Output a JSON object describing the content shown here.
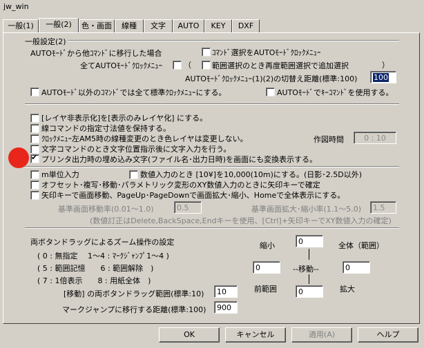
{
  "window": {
    "title": "jw_win"
  },
  "tabs": [
    "一般(1)",
    "一般(2)",
    "色・画面",
    "線種",
    "文字",
    "AUTO",
    "KEY",
    "DXF"
  ],
  "section_title": "一般設定(2)",
  "auto": {
    "heading": "AUTOﾓｰﾄﾞから他ｺﾏﾝﾄﾞに移行した場合",
    "cmd_select_label": "ｺﾏﾝﾄﾞ選択をAUTOﾓｰﾄﾞｸﾛｯｸﾒﾆｭｰ",
    "all_clock_label": "全てAUTOﾓｰﾄﾞｸﾛｯｸﾒﾆｭｰ",
    "range_select_label": "範囲選択のとき再度範囲選択で追加選択",
    "open_paren": "（",
    "close_paren": "）",
    "switch_distance_label": "AUTOﾓｰﾄﾞｸﾛｯｸﾒﾆｭｰ(1)(2)の切替え距離(標準:100)",
    "switch_distance_value": "100",
    "all_std_label": "AUTOﾓｰﾄﾞ以外のｺﾏﾝﾄﾞでは全て標準ｸﾛｯｸﾒﾆｭｰにする。",
    "key_cmd_label": "AUTOﾓｰﾄﾞでｷｰｺﾏﾝﾄﾞを使用する。"
  },
  "options": [
    {
      "label": "[レイヤ非表示化]を[表示のみレイヤ化] にする。",
      "checked": false
    },
    {
      "label": "線コマンドの指定寸法値を保持する。",
      "checked": false
    },
    {
      "label": "ｸﾛｯｸﾒﾆｭｰ左AM5時の線種変更のとき色レイヤは変更しない。",
      "checked": false
    },
    {
      "label": "文字コマンドのとき文字位置指示後に文字入力を行う。",
      "checked": false
    },
    {
      "label": "プリンタ出力時の埋め込み文字(ファイル名･出力日時)を画面にも変換表示する。",
      "checked": true
    }
  ],
  "drawing_time": {
    "label": "作図時間",
    "value": "0 : 10"
  },
  "m_unit_label": "m単位入力",
  "num_input_label": "数値入力のとき [10¥]を10,000(10m)にする。(日影･2.5D以外)",
  "offset_label": "オフセット･複写･移動･パラメトリック変形のXY数値入力のときに矢印キーで確定",
  "arrow_label": "矢印キーで画面移動、PageUp･PageDownで画面拡大･縮小、Homeで全体表示にする。",
  "move_rate": {
    "label": "基準画面移動率(0.01～1.0)",
    "value": "0.5"
  },
  "zoom_rate": {
    "label": "基準画面拡大･縮小率(1.1～5.0)",
    "value": "1.5"
  },
  "note": "(数値訂正はDelete,BackSpace,Endキーを使用、[Ctrl]+矢印キーでXY数値入力の確定)",
  "zoom": {
    "heading": "両ボタンドラッグによるズーム操作の設定",
    "line1": "( 0 : 無指定　 1～4 : ﾏｰｸｼﾞｬﾝﾌﾟ1～4 )",
    "line2": "( 5 : 範囲記憶　　6 : 範囲解除　)",
    "line3": "( 7 : 1倍表示　　8 : 用紙全体　)",
    "shrink_label": "縮小",
    "shrink_value": "0",
    "all_label": "全体（範囲）",
    "move_center_label": "--移動--",
    "left_value": "0",
    "right_value": "0",
    "prev_label": "前範囲",
    "prev_value": "0",
    "enlarge_label": "拡大",
    "move_range_label": "[移動] の両ボタンドラッグ範囲(標準:10)",
    "move_range_value": "10",
    "mark_jump_label": "マークジャンプに移行する距離(標準:100)",
    "mark_jump_value": "900"
  },
  "buttons": {
    "ok": "OK",
    "cancel": "キャンセル",
    "apply": "適用(A)",
    "help": "ヘルプ"
  }
}
